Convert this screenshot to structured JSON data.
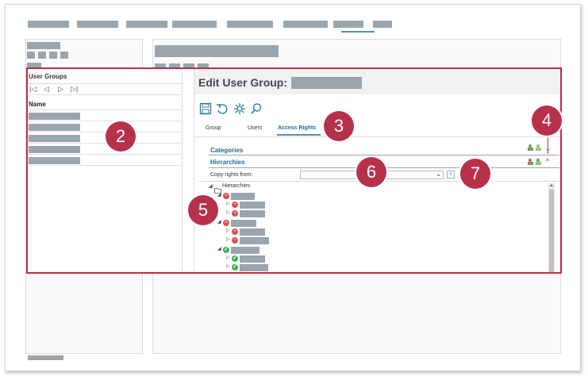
{
  "left_panel": {
    "title": "User Groups",
    "pager": {
      "first": "|◁",
      "prev": "◁",
      "next": "▷",
      "last": "▷|"
    },
    "column_name": "Name",
    "row_count": 5
  },
  "right_panel": {
    "title": "Edit User Group:",
    "tabs": [
      {
        "label": "Group"
      },
      {
        "label": "Users"
      },
      {
        "label": "Access Rights"
      }
    ],
    "sections": {
      "categories": "Categories",
      "hierarchies": "Hierarchies"
    },
    "copy_rights_label": "Copy rights from:",
    "copy_rights_button": "+",
    "tree_root": "Hierarchies"
  },
  "badges": [
    "2",
    "3",
    "4",
    "5",
    "6",
    "7"
  ],
  "colors": {
    "callout": "#b5324a",
    "accent": "#1f6e8c",
    "deny": "#d9534f",
    "allow": "#3fae5a"
  }
}
